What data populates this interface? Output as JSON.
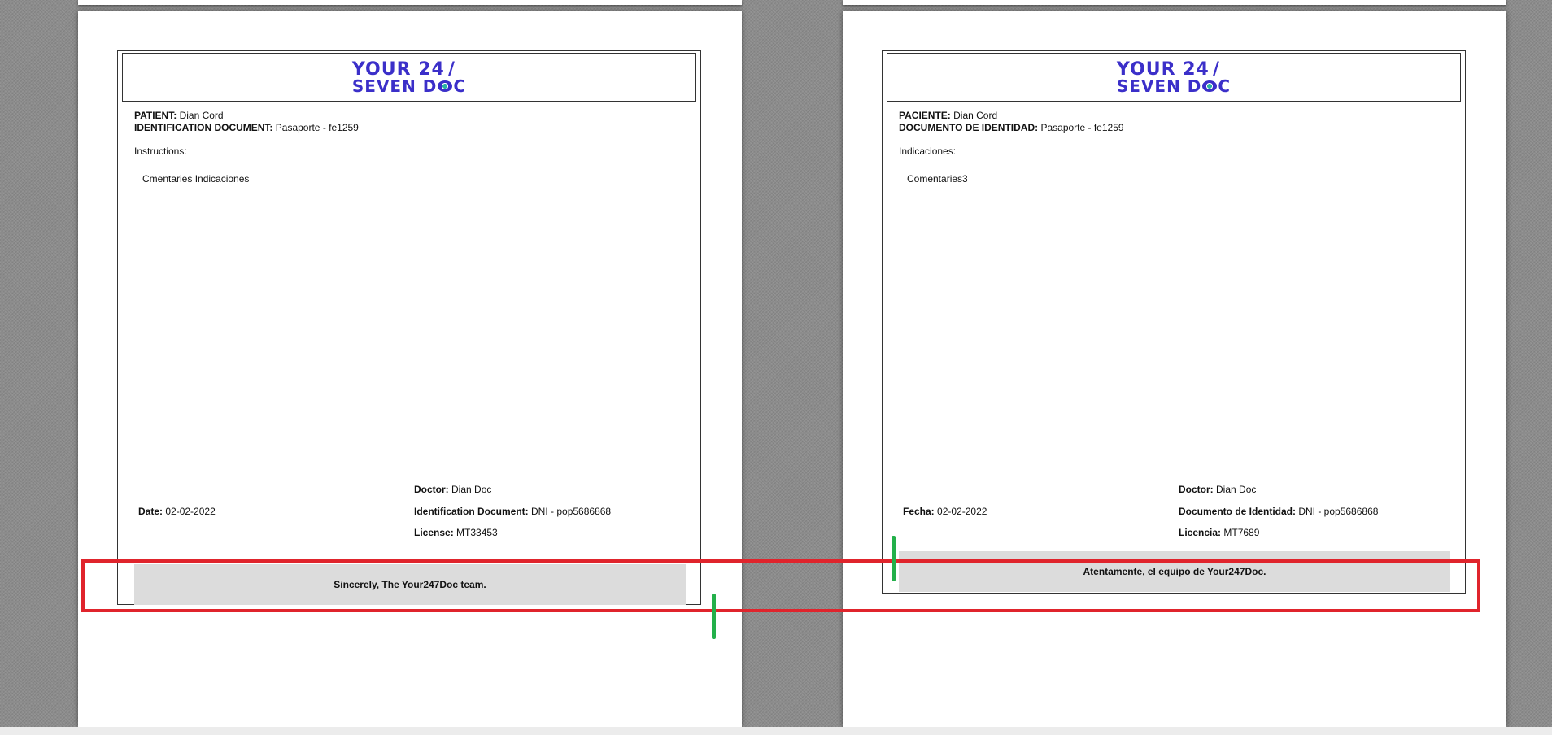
{
  "logo": {
    "line1": "YOUR 24",
    "slash": "/",
    "line2_left": "SEVEN D",
    "line2_right": "C"
  },
  "left_page": {
    "patient_label": "PATIENT:",
    "patient_name": "Dian Cord",
    "id_label": "IDENTIFICATION DOCUMENT:",
    "id_value": "Pasaporte - fe1259",
    "instructions_label": "Instructions:",
    "instructions_text": "Cmentaries Indicaciones",
    "date_label": "Date:",
    "date_value": "02-02-2022",
    "doctor_label": "Doctor:",
    "doctor_value": "Dian Doc",
    "doctor_id_label": "Identification Document:",
    "doctor_id_value": "DNI - pop5686868",
    "license_label": "License:",
    "license_value": "MT33453",
    "footer": "Sincerely, The Your247Doc team."
  },
  "right_page": {
    "patient_label": "PACIENTE:",
    "patient_name": "Dian Cord",
    "id_label": "DOCUMENTO DE IDENTIDAD:",
    "id_value": "Pasaporte - fe1259",
    "instructions_label": "Indicaciones:",
    "instructions_text": "Comentaries3",
    "date_label": "Fecha:",
    "date_value": "02-02-2022",
    "doctor_label": "Doctor:",
    "doctor_value": "Dian Doc",
    "doctor_id_label": "Documento de Identidad:",
    "doctor_id_value": "DNI - pop5686868",
    "license_label": "Licencia:",
    "license_value": "MT7689",
    "footer": "Atentamente, el equipo de Your247Doc."
  },
  "colors": {
    "logo_blue": "#3b2fc9",
    "logo_teal": "#2bb3a3",
    "highlight_red": "#e0242c",
    "marker_green": "#23b04a",
    "footer_gray": "#dcdcdc"
  }
}
